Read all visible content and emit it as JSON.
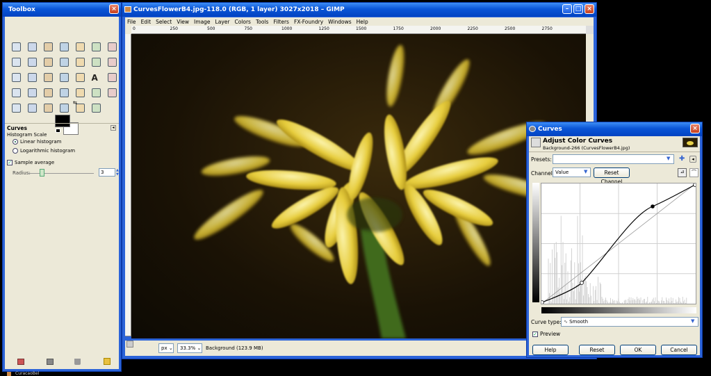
{
  "toolbox": {
    "title": "Toolbox",
    "panel_title": "Curves",
    "histogram_scale_label": "Histogram Scale",
    "linear_label": "Linear histogram",
    "log_label": "Logarithmic histogram",
    "sample_average_label": "Sample average",
    "radius_label": "Radius:",
    "radius_value": "3",
    "tools": [
      "rect-select",
      "ellipse-select",
      "free-select",
      "fuzzy-select",
      "select-by-color",
      "scissors-select",
      "foreground-select",
      "paths",
      "color-picker",
      "zoom",
      "measure",
      "move",
      "align",
      "crop",
      "rotate",
      "scale",
      "shear",
      "perspective",
      "flip",
      "text",
      "bucket-fill",
      "blend",
      "pencil",
      "paintbrush",
      "eraser",
      "airbrush",
      "ink",
      "clone",
      "heal",
      "perspective-clone",
      "blur",
      "smudge",
      "dodge-burn",
      "extra-tool"
    ]
  },
  "image_window": {
    "title": "CurvesFlowerB4.jpg-118.0 (RGB, 1 layer) 3027x2018 – GIMP",
    "menu": [
      "File",
      "Edit",
      "Select",
      "View",
      "Image",
      "Layer",
      "Colors",
      "Tools",
      "Filters",
      "FX-Foundry",
      "Windows",
      "Help"
    ],
    "ruler_labels": [
      "0",
      "250",
      "500",
      "750",
      "1000",
      "1250",
      "1500",
      "1750",
      "2000",
      "2250",
      "2500",
      "2750"
    ],
    "unit": "px",
    "zoom": "33.3%",
    "status_text": "Background (123.9 MB)"
  },
  "curves": {
    "title": "Curves",
    "heading": "Adjust Color Curves",
    "subheading": "Background-266 (CurvesFlowerB4.jpg)",
    "presets_label": "Presets:",
    "channel_label": "Channel:",
    "channel_value": "Value",
    "reset_channel_label": "Reset Channel",
    "curve_type_label": "Curve type:",
    "curve_type_value": "Smooth",
    "preview_label": "Preview",
    "help_label": "Help",
    "reset_label": "Reset",
    "ok_label": "OK",
    "cancel_label": "Cancel"
  },
  "taskbar": {
    "item_label": "CuracaoBel"
  },
  "colors": {
    "xp_blue": "#0a55d6",
    "panel": "#ece9d8",
    "accent_yellow": "#e8d24a"
  }
}
